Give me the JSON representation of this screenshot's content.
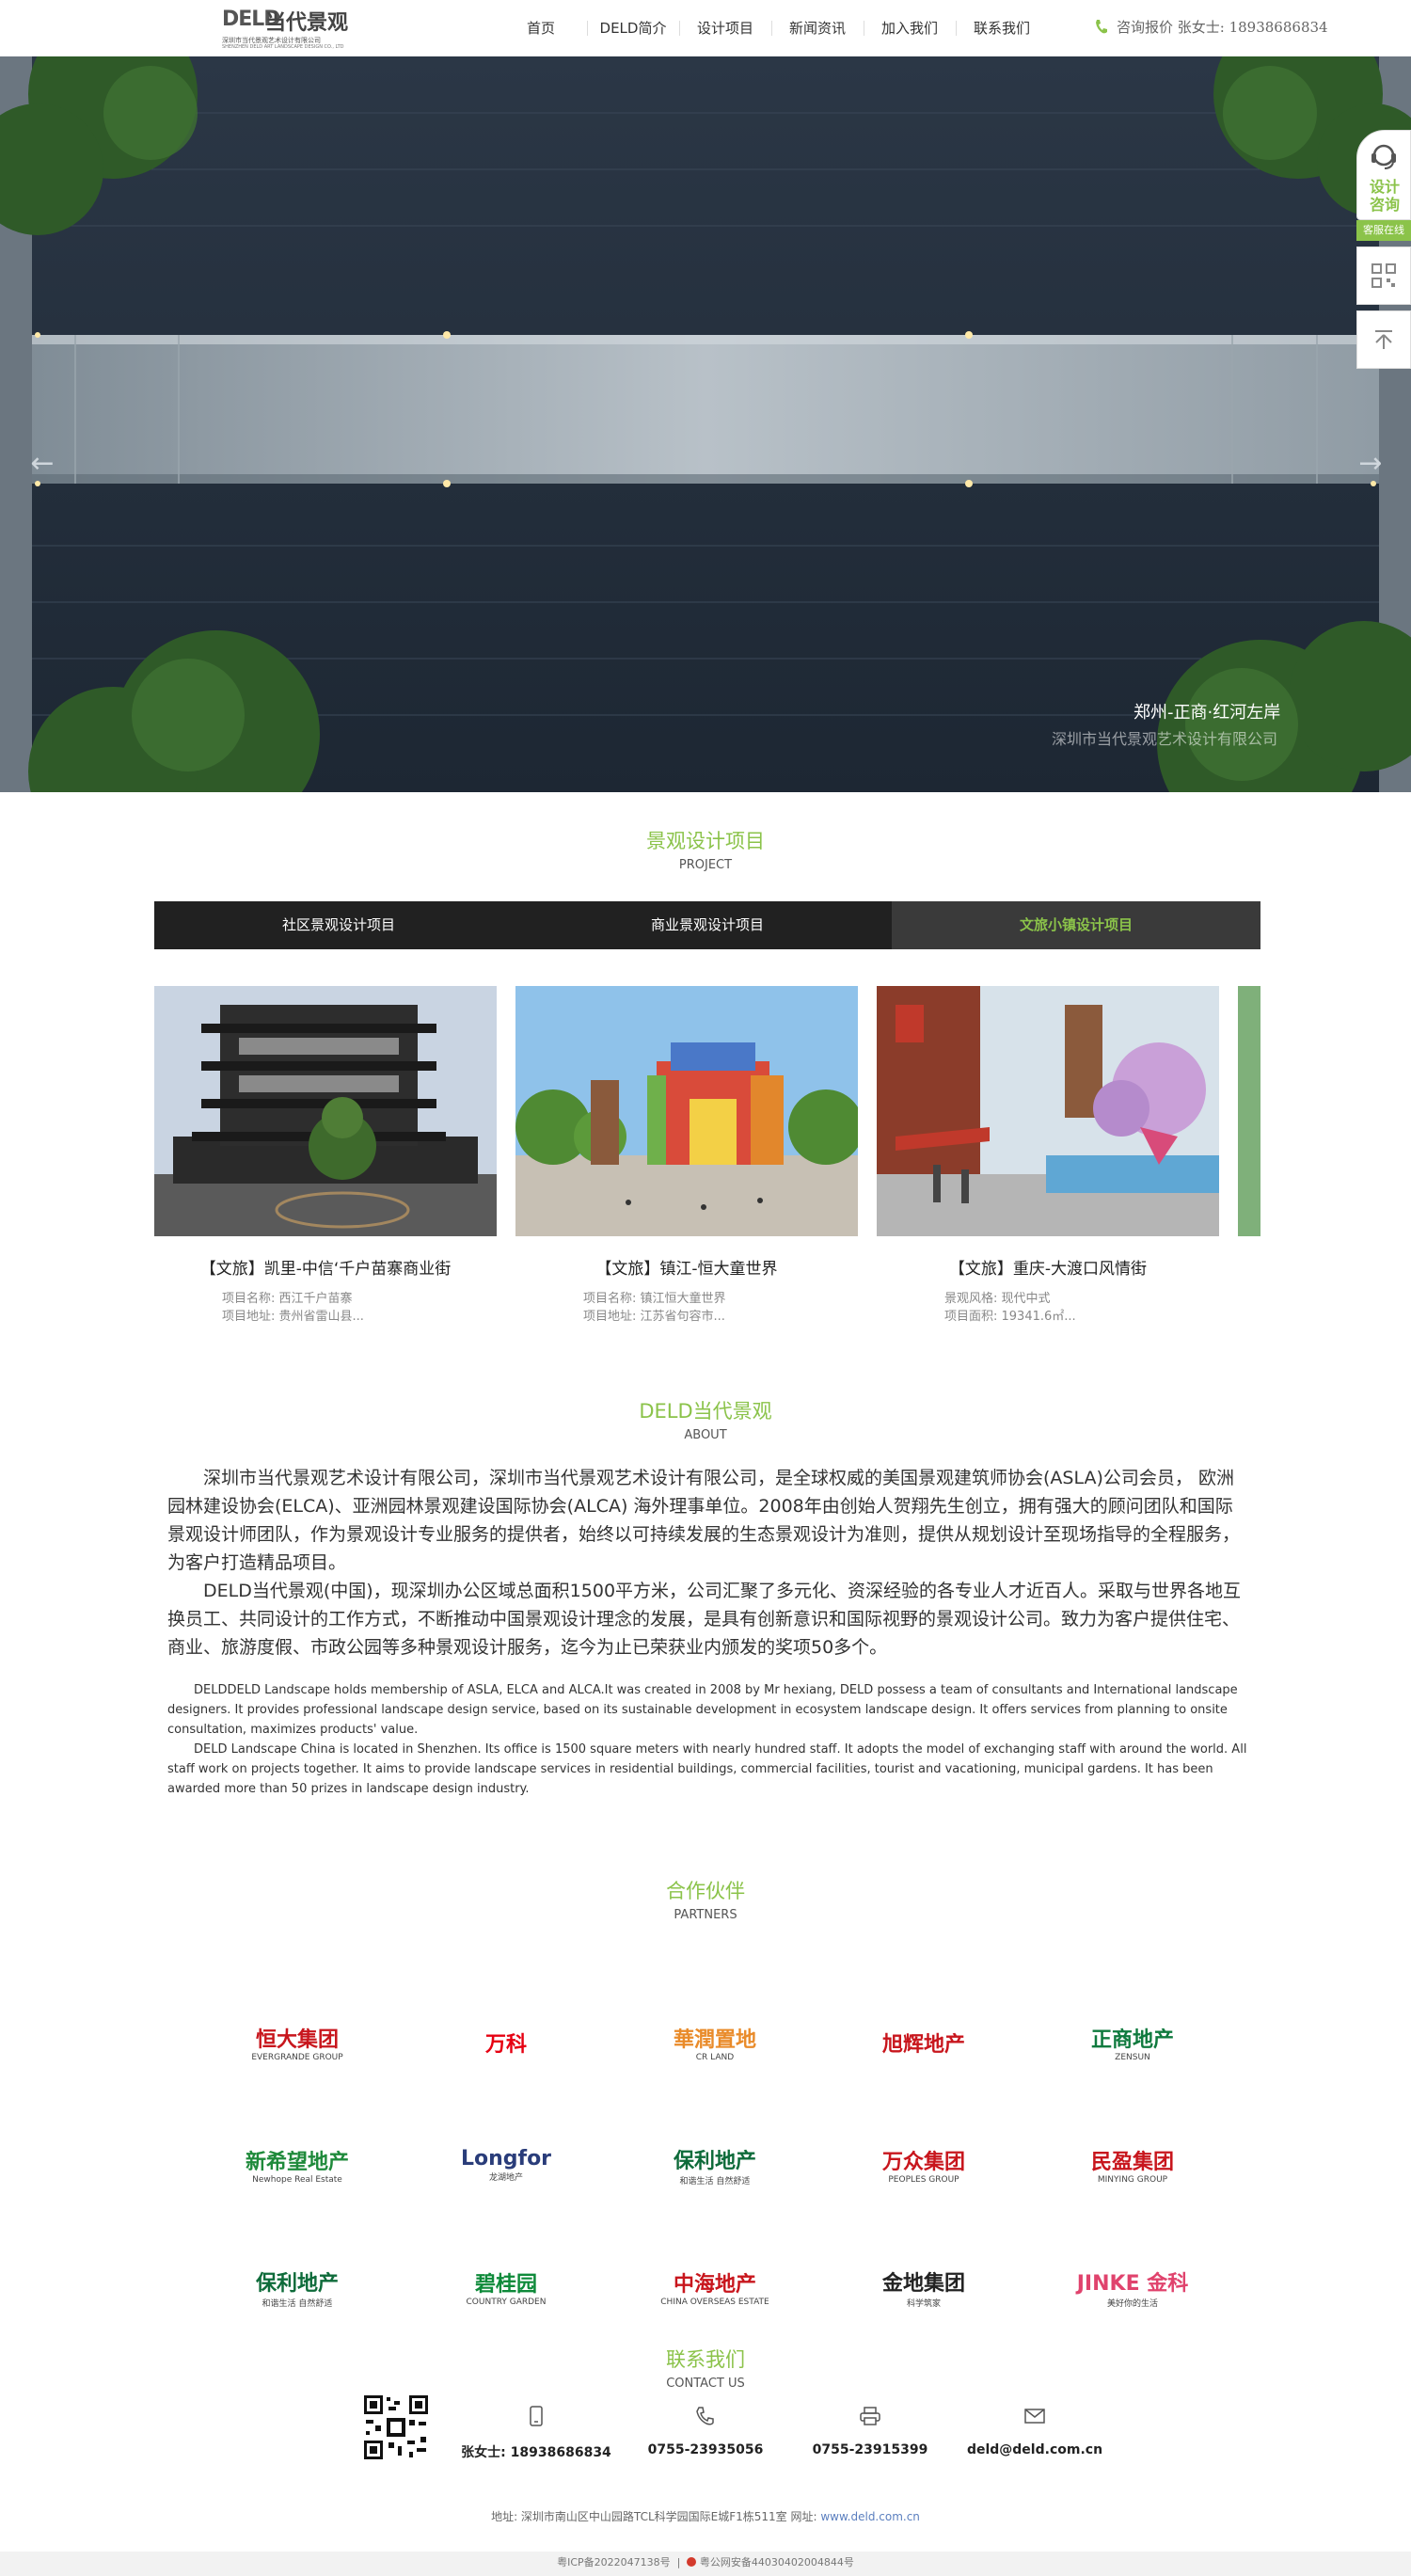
{
  "header": {
    "logo_mark": "DELD",
    "logo_cn": "当代景观",
    "logo_sub1": "深圳市当代景观艺术设计有限公司",
    "logo_sub2": "SHENZHEN DELD ART LANDSCAPE DESIGN CO., LTD",
    "nav": [
      "首页",
      "DELD简介",
      "设计项目",
      "新闻资讯",
      "加入我们",
      "联系我们"
    ],
    "contact": "咨询报价  张女士: 18938686834"
  },
  "banner": {
    "caption": "郑州-正商·红河左岸",
    "watermark": "深圳市当代景观艺术设计有限公司",
    "slide_count": 6,
    "active_slide": 4
  },
  "side": {
    "consult": "设计咨询",
    "online": "客服在线"
  },
  "projects_section": {
    "title": "景观设计项目",
    "subtitle": "PROJECT",
    "tabs": [
      "社区景观设计项目",
      "商业景观设计项目",
      "文旅小镇设计项目"
    ],
    "active_tab": 2,
    "items": [
      {
        "title": "【文旅】凯里-中信‘千户苗寨商业街",
        "line1": "项目名称:  西江千户苗寨",
        "line2": "项目地址:  贵州省雷山县..."
      },
      {
        "title": "【文旅】镇江-恒大童世界",
        "line1": "项目名称:  镇江恒大童世界",
        "line2": "项目地址:  江苏省句容市..."
      },
      {
        "title": "【文旅】重庆-大渡口风情街",
        "line1": "景观风格:  现代中式",
        "line2": "项目面积:  19341.6㎡..."
      }
    ]
  },
  "about": {
    "title": "DELD当代景观",
    "subtitle": "ABOUT",
    "cn_p1": "深圳市当代景观艺术设计有限公司，深圳市当代景观艺术设计有限公司，是全球权威的美国景观建筑师协会(ASLA)公司会员， 欧洲园林建设协会(ELCA)、亚洲园林景观建设国际协会(ALCA) 海外理事单位。2008年由创始人贺翔先生创立，拥有强大的顾问团队和国际景观设计师团队，作为景观设计专业服务的提供者，始终以可持续发展的生态景观设计为准则，提供从规划设计至现场指导的全程服务，为客户打造精品项目。",
    "cn_p2": "DELD当代景观(中国)，现深圳办公区域总面积1500平方米，公司汇聚了多元化、资深经验的各专业人才近百人。采取与世界各地互换员工、共同设计的工作方式，不断推动中国景观设计理念的发展，是具有创新意识和国际视野的景观设计公司。致力为客户提供住宅、商业、旅游度假、市政公园等多种景观设计服务，迄今为止已荣获业内颁发的奖项50多个。",
    "en_p1": "DELDDELD Landscape  holds membership of ASLA, ELCA and ALCA.It was created in 2008 by Mr hexiang,  DELD possess a team of consultants and International landscape designers. It provides professional landscape design service, based on its sustainable development in ecosystem landscape design. It offers services from planning to onsite consultation, maximizes products'   value.",
    "en_p2": "DELD Landscape China is located in Shenzhen. Its office is 1500 square meters with nearly hundred staff. It adopts the model of exchanging staff with around the world. All staff work on projects together. It aims to provide landscape services in residential buildings, commercial facilities, tourist and vacationing, municipal gardens. It has been awarded more than 50 prizes in landscape design industry."
  },
  "partners": {
    "title": "合作伙伴",
    "subtitle": "PARTNERS",
    "logos": [
      {
        "cn": "恒大集团",
        "en": "EVERGRANDE GROUP",
        "color": "#c8161d"
      },
      {
        "cn": "万科",
        "en": "",
        "color": "#e60012"
      },
      {
        "cn": "華潤置地",
        "en": "CR LAND",
        "color": "#e98b2a"
      },
      {
        "cn": "旭辉地产",
        "en": "",
        "color": "#c8161d"
      },
      {
        "cn": "正商地产",
        "en": "ZENSUN",
        "color": "#0f7a3e"
      },
      {
        "cn": "新希望地产",
        "en": "Newhope Real Estate",
        "color": "#1f8a3b"
      },
      {
        "cn": "Longfor",
        "en": "龙湖地产",
        "color": "#2a3d7a"
      },
      {
        "cn": "保利地产",
        "en": "和谐生活 自然舒适",
        "color": "#0e6b3a"
      },
      {
        "cn": "万众集团",
        "en": "PEOPLES GROUP",
        "color": "#c8161d"
      },
      {
        "cn": "民盈集团",
        "en": "MINYING GROUP",
        "color": "#c8161d"
      },
      {
        "cn": "保利地产",
        "en": "和谐生活 自然舒适",
        "color": "#0e6b3a"
      },
      {
        "cn": "碧桂园",
        "en": "COUNTRY GARDEN",
        "color": "#0e8a3a"
      },
      {
        "cn": "中海地产",
        "en": "CHINA OVERSEAS ESTATE",
        "color": "#c8161d"
      },
      {
        "cn": "金地集团",
        "en": "科学筑家",
        "color": "#222222"
      },
      {
        "cn": "JINKE 金科",
        "en": "美好你的生活",
        "color": "#e0436d"
      }
    ]
  },
  "contact": {
    "title": "联系我们",
    "subtitle": "CONTACT US",
    "mobile": "张女士: 18938686834",
    "phone": "0755-23935056",
    "fax": "0755-23915399",
    "email": "deld@deld.com.cn",
    "address_prefix": "地址:  深圳市南山区中山园路TCL科学园国际E城F1栋511室     网址:  ",
    "website": "www.deld.com.cn",
    "icp": "粤ICP备2022047138号",
    "police": "粤公网安备44030402004844号"
  },
  "colors": {
    "accent": "#8bc34a",
    "tab_bg": "#212121"
  }
}
